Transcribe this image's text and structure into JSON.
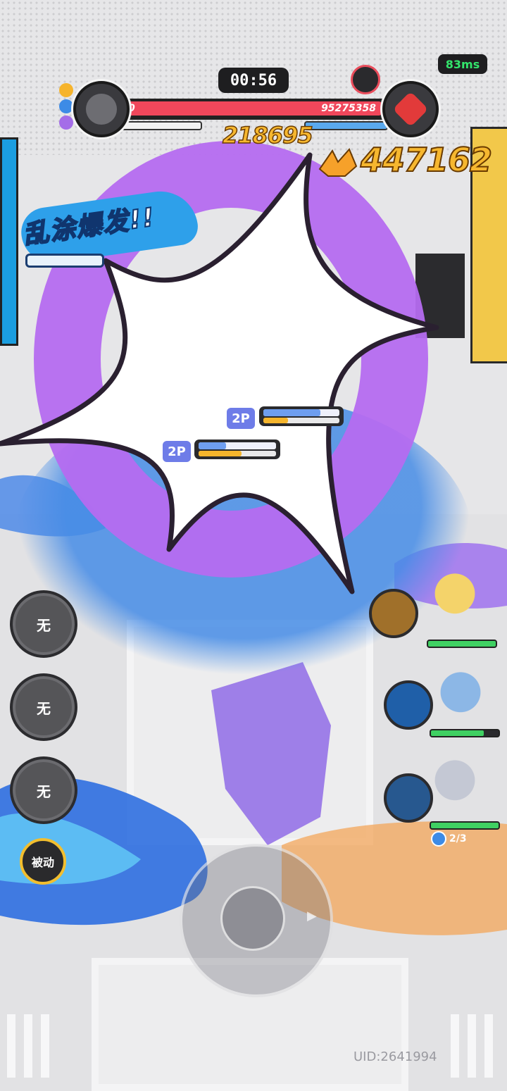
{
  "hud": {
    "ping": "83ms",
    "timer": "00:56",
    "left_team": {
      "hp_value": "0"
    },
    "right_team": {
      "hp_value": "95275358"
    }
  },
  "scores": {
    "left_damage": "218695",
    "right_damage": "447162"
  },
  "skill_banner": {
    "text": "乱涂爆发!!"
  },
  "player_tags": [
    {
      "label": "2P",
      "top_ratio": 0.75,
      "bottom_ratio": 0.32
    },
    {
      "label": "2P",
      "top_ratio": 0.35,
      "bottom_ratio": 0.55
    }
  ],
  "skill_buttons": [
    {
      "label": "无"
    },
    {
      "label": "无"
    },
    {
      "label": "无"
    }
  ],
  "passive_button": {
    "label": "被动"
  },
  "team": [
    {
      "name": "",
      "hp_ratio": 1.0,
      "skill_color": "#a0702a",
      "avatar_color": "#f4d36a"
    },
    {
      "name": "",
      "hp_ratio": 0.78,
      "skill_color": "#1f5fa8",
      "avatar_color": "#8cb7e6"
    },
    {
      "name": "",
      "hp_ratio": 1.0,
      "skill_color": "#27588f",
      "avatar_color": "#c4c8d4"
    }
  ],
  "ammo": {
    "count": "2/3"
  },
  "uid": "UID:2641994",
  "colors": {
    "hp_red": "#f0475b",
    "score_gold": "#f6b72f",
    "ring_purple": "#b56cf0",
    "effect_blue": "#2ea0ea",
    "ping_green": "#33e46b"
  }
}
